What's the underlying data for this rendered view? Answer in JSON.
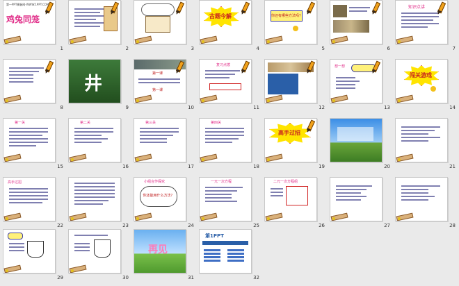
{
  "slides": [
    {
      "num": "1",
      "title": "鸡兔同笼",
      "caption": "第一PPT模板网-WWW.1PPT.COM"
    },
    {
      "num": "2"
    },
    {
      "num": "3"
    },
    {
      "num": "4",
      "banner": "古题今解"
    },
    {
      "num": "5",
      "caption": "你还有哪些方法吗？"
    },
    {
      "num": "6"
    },
    {
      "num": "7",
      "heading": "知识点讲"
    },
    {
      "num": "8"
    },
    {
      "num": "9",
      "glyph": "井"
    },
    {
      "num": "10",
      "heading": "第一课",
      "subheading": "第一课"
    },
    {
      "num": "11",
      "heading": "复习点拨"
    },
    {
      "num": "12"
    },
    {
      "num": "13",
      "heading": "想一想"
    },
    {
      "num": "14",
      "banner": "闯关游戏"
    },
    {
      "num": "15",
      "heading": "第一关"
    },
    {
      "num": "16",
      "heading": "第二关"
    },
    {
      "num": "17",
      "heading": "第三关"
    },
    {
      "num": "18",
      "heading": "第四关"
    },
    {
      "num": "19",
      "banner": "高手过招"
    },
    {
      "num": "20"
    },
    {
      "num": "21"
    },
    {
      "num": "22",
      "heading": "高手过招"
    },
    {
      "num": "23"
    },
    {
      "num": "24",
      "heading": "小组合作探究",
      "caption": "你还能用什么方法？"
    },
    {
      "num": "25",
      "heading": "一元一次方程"
    },
    {
      "num": "26",
      "heading": "二元一次方程组"
    },
    {
      "num": "27"
    },
    {
      "num": "28"
    },
    {
      "num": "29"
    },
    {
      "num": "30"
    },
    {
      "num": "31",
      "banner": "再见"
    },
    {
      "num": "32",
      "heading": "第1PPT"
    }
  ],
  "colors": {
    "accent": "#e1308a",
    "border": "#c8c8c8",
    "background": "#eaeaea"
  }
}
